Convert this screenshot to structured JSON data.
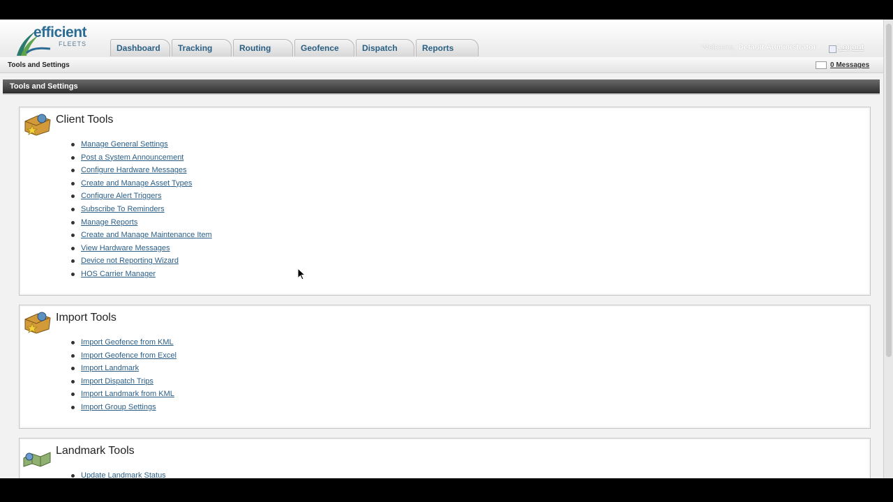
{
  "logo": {
    "word": "efficient",
    "sub": "FLEETS"
  },
  "nav": {
    "tabs": [
      "Dashboard",
      "Tracking",
      "Routing",
      "Geofence",
      "Dispatch",
      "Reports"
    ]
  },
  "user": {
    "welcome": "Welcome,",
    "name": "Default Administrator",
    "logout": "Logout"
  },
  "breadcrumb": "Tools and Settings",
  "messages": "0 Messages",
  "page_header": "Tools and Settings",
  "panels": [
    {
      "title": "Client Tools",
      "links": [
        "Manage General Settings",
        "Post a System Announcement",
        "Configure Hardware Messages",
        "Create and Manage Asset Types",
        "Configure Alert Triggers",
        "Subscribe To Reminders",
        "Manage Reports",
        "Create and Manage Maintenance Item",
        "View Hardware Messages",
        "Device not Reporting Wizard",
        "HOS Carrier Manager"
      ]
    },
    {
      "title": "Import Tools",
      "links": [
        "Import Geofence from KML",
        "Import Geofence from Excel",
        "Import Landmark",
        "Import Dispatch Trips",
        "Import Landmark from KML",
        "Import Group Settings"
      ]
    },
    {
      "title": "Landmark Tools",
      "links": [
        "Update Landmark Status"
      ]
    }
  ]
}
